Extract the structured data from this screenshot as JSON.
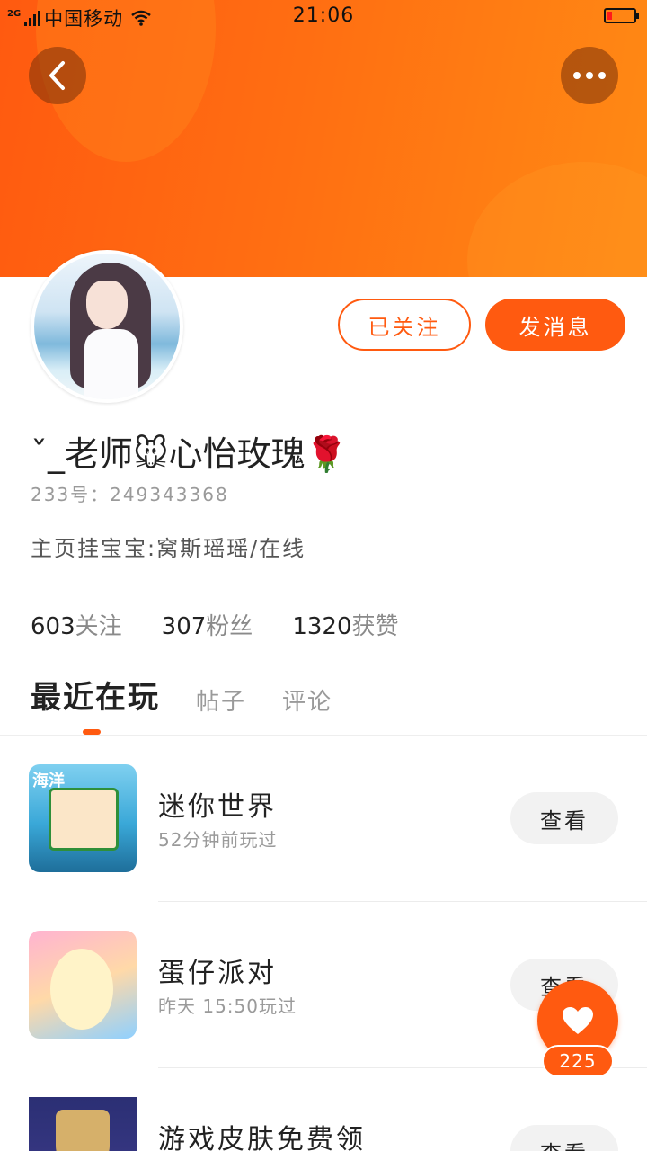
{
  "status_bar": {
    "network": "2G",
    "carrier": "中国移动",
    "time": "21:06"
  },
  "profile": {
    "name": "ˇ_老师🐭心怡玫瑰🌹",
    "id_line": "233号：249343368",
    "bio": "主页挂宝宝:窝斯瑶瑶/在线",
    "follow_button": "已关注",
    "message_button": "发消息"
  },
  "stats": [
    {
      "num": "603",
      "label": "关注"
    },
    {
      "num": "307",
      "label": "粉丝"
    },
    {
      "num": "1320",
      "label": "获赞"
    }
  ],
  "tabs": [
    {
      "label": "最近在玩",
      "active": true
    },
    {
      "label": "帖子",
      "active": false
    },
    {
      "label": "评论",
      "active": false
    }
  ],
  "games": [
    {
      "title": "迷你世界",
      "subtitle": "52分钟前玩过",
      "button": "查看",
      "thumb_label": "海洋"
    },
    {
      "title": "蛋仔派对",
      "subtitle": "昨天 15:50玩过",
      "button": "查看"
    },
    {
      "title": "游戏皮肤免费领",
      "subtitle": "",
      "button": "查看"
    }
  ],
  "like": {
    "count": "225"
  },
  "colors": {
    "accent": "#ff5a10",
    "banner_start": "#ff5a10",
    "banner_end": "#ff8a14"
  }
}
